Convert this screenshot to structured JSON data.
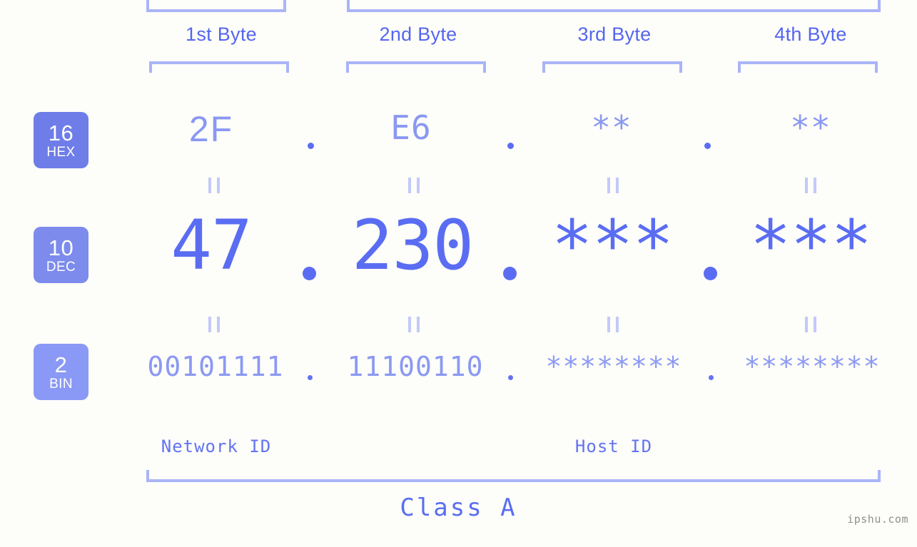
{
  "bytes": {
    "headers": [
      {
        "label": "1st Byte"
      },
      {
        "label": "2nd Byte"
      },
      {
        "label": "3rd Byte"
      },
      {
        "label": "4th Byte"
      }
    ]
  },
  "bases": [
    {
      "number": "16",
      "name": "HEX",
      "color": "#6e7de8"
    },
    {
      "number": "10",
      "name": "DEC",
      "color": "#7c8bec"
    },
    {
      "number": "2",
      "name": "BIN",
      "color": "#8a99f5"
    }
  ],
  "rows": {
    "hex": {
      "values": [
        "2F",
        "E6",
        "**",
        "**"
      ],
      "separator": "."
    },
    "dec": {
      "values": [
        "47",
        "230",
        "***",
        "***"
      ],
      "separator": "."
    },
    "bin": {
      "values": [
        "00101111",
        "11100110",
        "********",
        "********"
      ],
      "separator": "."
    }
  },
  "equality_marks": {
    "symbol": "=",
    "count": 8
  },
  "segments": {
    "network_id": "Network ID",
    "host_id": "Host ID",
    "class": "Class A"
  },
  "watermark": "ipshu.com",
  "colors": {
    "background": "#fdfdfa",
    "accent": "#5a6df2",
    "accent_light": "#8b99f2",
    "bracket": "#aab4f7",
    "equals": "#c3c9f8",
    "watermark": "#8f8f8f"
  }
}
